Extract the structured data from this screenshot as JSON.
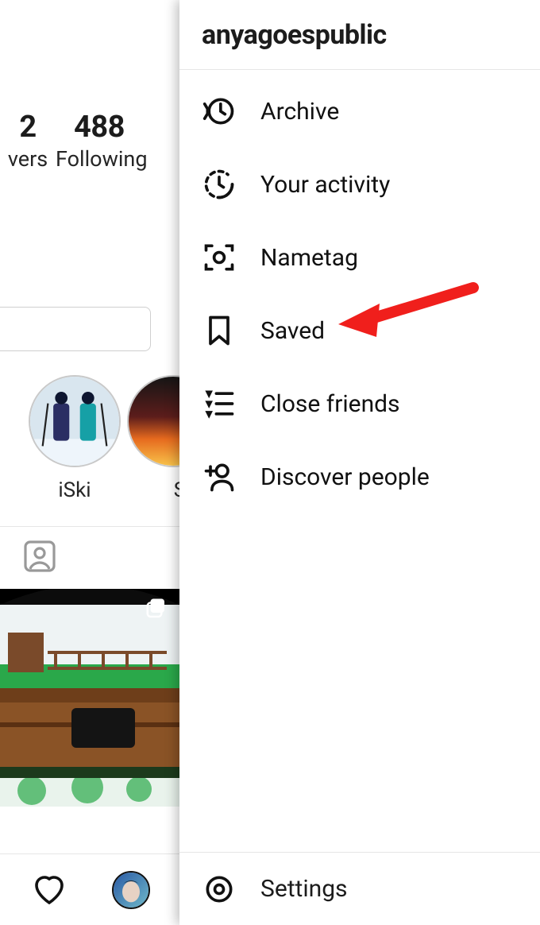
{
  "profile": {
    "stats": [
      {
        "value": "2",
        "label": "vers"
      },
      {
        "value": "488",
        "label": "Following"
      }
    ],
    "highlights": [
      {
        "label": "iSki"
      },
      {
        "label": "Sk"
      }
    ]
  },
  "drawer": {
    "username": "anyagoespublic",
    "items": [
      {
        "icon": "archive-icon",
        "label": "Archive"
      },
      {
        "icon": "activity-icon",
        "label": "Your activity"
      },
      {
        "icon": "nametag-icon",
        "label": "Nametag"
      },
      {
        "icon": "saved-icon",
        "label": "Saved"
      },
      {
        "icon": "close-friends-icon",
        "label": "Close friends"
      },
      {
        "icon": "discover-people-icon",
        "label": "Discover people"
      }
    ],
    "footer": {
      "icon": "settings-icon",
      "label": "Settings"
    }
  },
  "annotation": {
    "arrow_color": "#f01f1c",
    "target_item_index": 3
  }
}
